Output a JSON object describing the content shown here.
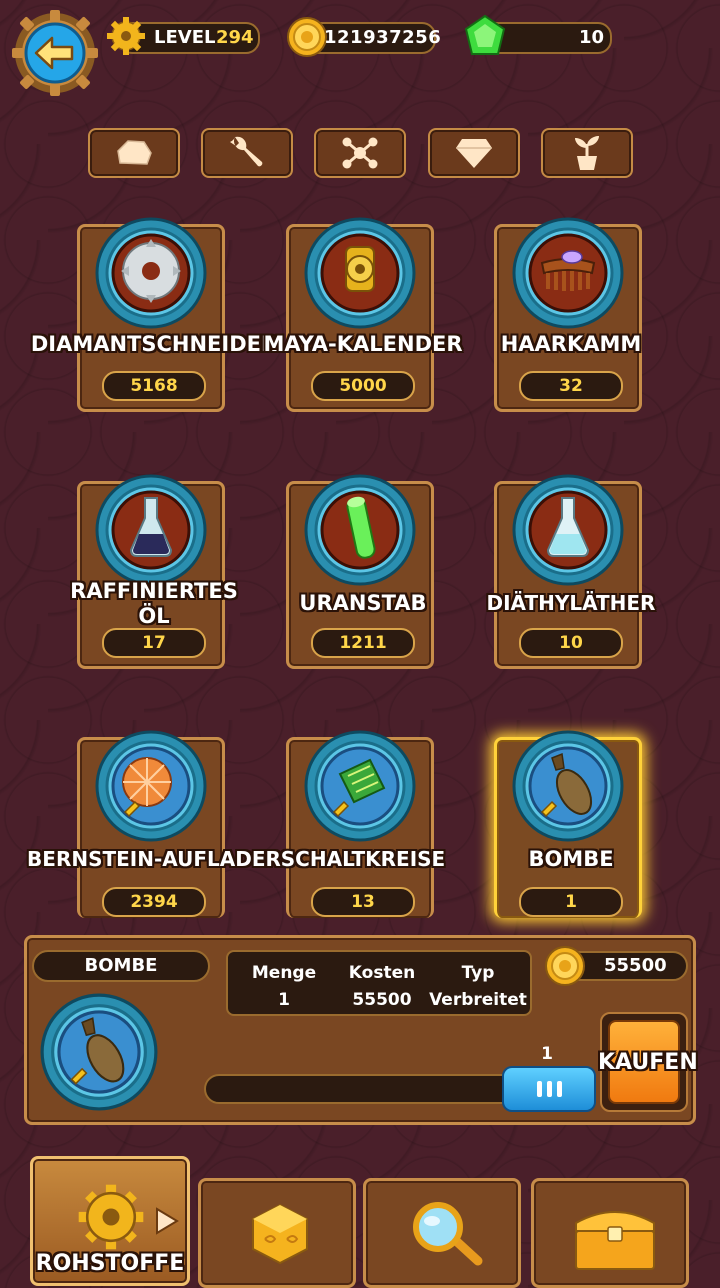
{
  "header": {
    "level_label": "LEVEL",
    "level_value": "294",
    "coins": "121937256",
    "gems": "10"
  },
  "categories": [
    {
      "icon": "ore-icon"
    },
    {
      "icon": "wrench-icon"
    },
    {
      "icon": "molecule-icon"
    },
    {
      "icon": "diamond-icon"
    },
    {
      "icon": "plant-icon"
    }
  ],
  "items": [
    {
      "name": "DIAMANTSCHNEIDER",
      "count": "5168",
      "icon": "saw-blade-icon"
    },
    {
      "name": "MAYA-KALENDER",
      "count": "5000",
      "icon": "maya-calendar-icon"
    },
    {
      "name": "HAARKAMM",
      "count": "32",
      "icon": "comb-icon"
    },
    {
      "name_line1": "RAFFINIERTES",
      "name_line2": "ÖL",
      "count": "17",
      "icon": "oil-flask-icon"
    },
    {
      "name": "URANSTAB",
      "count": "1211",
      "icon": "uranium-rod-icon"
    },
    {
      "name": "DIÄTHYLÄTHER",
      "count": "10",
      "icon": "ether-flask-icon"
    },
    {
      "name": "BERNSTEIN-AUFLADER",
      "count": "2394",
      "icon": "amber-charger-icon"
    },
    {
      "name": "SCHALTKREISE",
      "count": "13",
      "icon": "circuit-board-icon"
    },
    {
      "name": "BOMBE",
      "count": "1",
      "icon": "bomb-icon"
    }
  ],
  "detail": {
    "name": "BOMBE",
    "menge_label": "Menge",
    "menge_value": "1",
    "kosten_label": "Kosten",
    "kosten_value": "55500",
    "typ_label": "Typ",
    "typ_value": "Verbreitet",
    "price": "55500",
    "slider_value": "1",
    "buy_label": "KAUFEN"
  },
  "bottom_tabs": {
    "rohstoffe_label": "ROHSTOFFE"
  },
  "colors": {
    "background": "#4a1f2a",
    "gold_text": "#ffd64a",
    "card": "#7a4722",
    "selected_glow": "#ffcc33",
    "slider": "#1e8ed8",
    "buy": "#f07a10"
  }
}
